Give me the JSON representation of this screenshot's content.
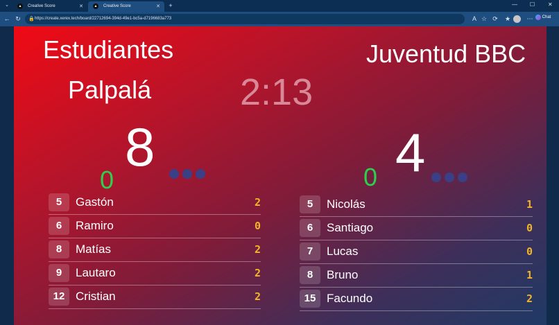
{
  "browser": {
    "tabs": [
      {
        "label": "Creative Score",
        "icon": "creative-score-favicon"
      },
      {
        "label": "Creative Score",
        "icon": "creative-score-favicon"
      }
    ],
    "url": "https://create.xerex.tech/board/22712694-394d-49e1-bc5a-d7196683a773",
    "chat_label": "Chat"
  },
  "scoreboard": {
    "clock": "2:13",
    "home": {
      "name_line1": "Estudiantes",
      "name_line2": "Palpalá",
      "score": "8",
      "fouls": "0",
      "color": "#ff0000",
      "players": [
        {
          "number": "5",
          "name": "Gastón",
          "points": "2"
        },
        {
          "number": "6",
          "name": "Ramiro",
          "points": "0"
        },
        {
          "number": "8",
          "name": "Matías",
          "points": "2"
        },
        {
          "number": "9",
          "name": "Lautaro",
          "points": "2"
        },
        {
          "number": "12",
          "name": "Cristian",
          "points": "2"
        }
      ]
    },
    "away": {
      "name": "Juventud BBC",
      "score": "4",
      "fouls": "0",
      "color": "#1f3a65",
      "players": [
        {
          "number": "5",
          "name": "Nicolás",
          "points": "1"
        },
        {
          "number": "6",
          "name": "Santiago",
          "points": "0"
        },
        {
          "number": "7",
          "name": "Lucas",
          "points": "0"
        },
        {
          "number": "8",
          "name": "Bruno",
          "points": "1"
        },
        {
          "number": "15",
          "name": "Facundo",
          "points": "2"
        }
      ]
    }
  }
}
